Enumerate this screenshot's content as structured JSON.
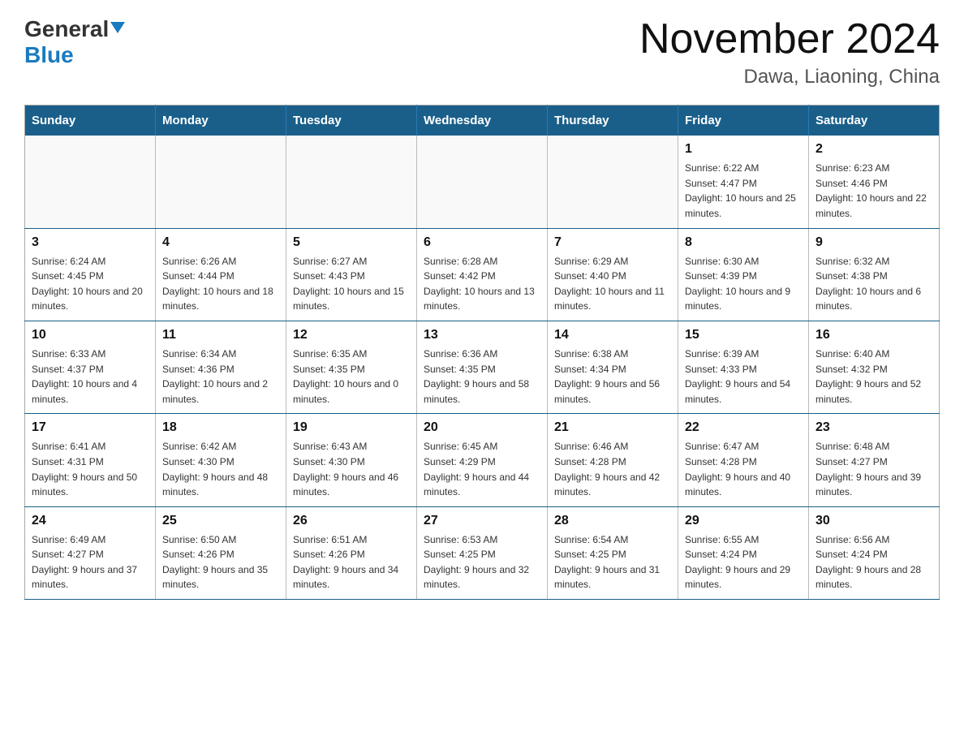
{
  "logo": {
    "general": "General",
    "blue": "Blue",
    "alt": "GeneralBlue logo"
  },
  "header": {
    "month": "November 2024",
    "location": "Dawa, Liaoning, China"
  },
  "weekdays": [
    "Sunday",
    "Monday",
    "Tuesday",
    "Wednesday",
    "Thursday",
    "Friday",
    "Saturday"
  ],
  "weeks": [
    [
      {
        "day": "",
        "info": ""
      },
      {
        "day": "",
        "info": ""
      },
      {
        "day": "",
        "info": ""
      },
      {
        "day": "",
        "info": ""
      },
      {
        "day": "",
        "info": ""
      },
      {
        "day": "1",
        "info": "Sunrise: 6:22 AM\nSunset: 4:47 PM\nDaylight: 10 hours and 25 minutes."
      },
      {
        "day": "2",
        "info": "Sunrise: 6:23 AM\nSunset: 4:46 PM\nDaylight: 10 hours and 22 minutes."
      }
    ],
    [
      {
        "day": "3",
        "info": "Sunrise: 6:24 AM\nSunset: 4:45 PM\nDaylight: 10 hours and 20 minutes."
      },
      {
        "day": "4",
        "info": "Sunrise: 6:26 AM\nSunset: 4:44 PM\nDaylight: 10 hours and 18 minutes."
      },
      {
        "day": "5",
        "info": "Sunrise: 6:27 AM\nSunset: 4:43 PM\nDaylight: 10 hours and 15 minutes."
      },
      {
        "day": "6",
        "info": "Sunrise: 6:28 AM\nSunset: 4:42 PM\nDaylight: 10 hours and 13 minutes."
      },
      {
        "day": "7",
        "info": "Sunrise: 6:29 AM\nSunset: 4:40 PM\nDaylight: 10 hours and 11 minutes."
      },
      {
        "day": "8",
        "info": "Sunrise: 6:30 AM\nSunset: 4:39 PM\nDaylight: 10 hours and 9 minutes."
      },
      {
        "day": "9",
        "info": "Sunrise: 6:32 AM\nSunset: 4:38 PM\nDaylight: 10 hours and 6 minutes."
      }
    ],
    [
      {
        "day": "10",
        "info": "Sunrise: 6:33 AM\nSunset: 4:37 PM\nDaylight: 10 hours and 4 minutes."
      },
      {
        "day": "11",
        "info": "Sunrise: 6:34 AM\nSunset: 4:36 PM\nDaylight: 10 hours and 2 minutes."
      },
      {
        "day": "12",
        "info": "Sunrise: 6:35 AM\nSunset: 4:35 PM\nDaylight: 10 hours and 0 minutes."
      },
      {
        "day": "13",
        "info": "Sunrise: 6:36 AM\nSunset: 4:35 PM\nDaylight: 9 hours and 58 minutes."
      },
      {
        "day": "14",
        "info": "Sunrise: 6:38 AM\nSunset: 4:34 PM\nDaylight: 9 hours and 56 minutes."
      },
      {
        "day": "15",
        "info": "Sunrise: 6:39 AM\nSunset: 4:33 PM\nDaylight: 9 hours and 54 minutes."
      },
      {
        "day": "16",
        "info": "Sunrise: 6:40 AM\nSunset: 4:32 PM\nDaylight: 9 hours and 52 minutes."
      }
    ],
    [
      {
        "day": "17",
        "info": "Sunrise: 6:41 AM\nSunset: 4:31 PM\nDaylight: 9 hours and 50 minutes."
      },
      {
        "day": "18",
        "info": "Sunrise: 6:42 AM\nSunset: 4:30 PM\nDaylight: 9 hours and 48 minutes."
      },
      {
        "day": "19",
        "info": "Sunrise: 6:43 AM\nSunset: 4:30 PM\nDaylight: 9 hours and 46 minutes."
      },
      {
        "day": "20",
        "info": "Sunrise: 6:45 AM\nSunset: 4:29 PM\nDaylight: 9 hours and 44 minutes."
      },
      {
        "day": "21",
        "info": "Sunrise: 6:46 AM\nSunset: 4:28 PM\nDaylight: 9 hours and 42 minutes."
      },
      {
        "day": "22",
        "info": "Sunrise: 6:47 AM\nSunset: 4:28 PM\nDaylight: 9 hours and 40 minutes."
      },
      {
        "day": "23",
        "info": "Sunrise: 6:48 AM\nSunset: 4:27 PM\nDaylight: 9 hours and 39 minutes."
      }
    ],
    [
      {
        "day": "24",
        "info": "Sunrise: 6:49 AM\nSunset: 4:27 PM\nDaylight: 9 hours and 37 minutes."
      },
      {
        "day": "25",
        "info": "Sunrise: 6:50 AM\nSunset: 4:26 PM\nDaylight: 9 hours and 35 minutes."
      },
      {
        "day": "26",
        "info": "Sunrise: 6:51 AM\nSunset: 4:26 PM\nDaylight: 9 hours and 34 minutes."
      },
      {
        "day": "27",
        "info": "Sunrise: 6:53 AM\nSunset: 4:25 PM\nDaylight: 9 hours and 32 minutes."
      },
      {
        "day": "28",
        "info": "Sunrise: 6:54 AM\nSunset: 4:25 PM\nDaylight: 9 hours and 31 minutes."
      },
      {
        "day": "29",
        "info": "Sunrise: 6:55 AM\nSunset: 4:24 PM\nDaylight: 9 hours and 29 minutes."
      },
      {
        "day": "30",
        "info": "Sunrise: 6:56 AM\nSunset: 4:24 PM\nDaylight: 9 hours and 28 minutes."
      }
    ]
  ]
}
